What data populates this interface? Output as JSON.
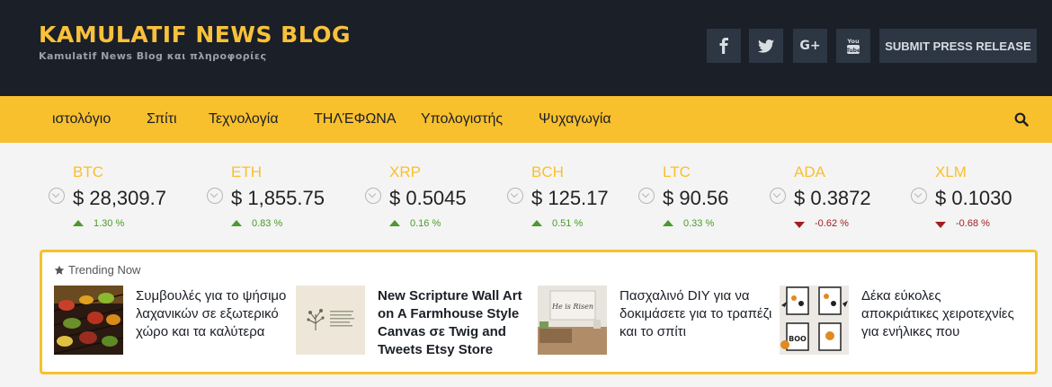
{
  "header": {
    "title": "KAMULATIF NEWS BLOG",
    "tagline": "Kamulatif News Blog και πληροφορίες",
    "social": [
      {
        "icon": "facebook-icon",
        "label": "f"
      },
      {
        "icon": "twitter-icon"
      },
      {
        "icon": "google-plus-icon",
        "label": "G+"
      },
      {
        "icon": "youtube-icon",
        "label": "You Tube"
      }
    ],
    "submit_label": "SUBMIT PRESS RELEASE"
  },
  "nav": {
    "items": [
      "ιστολόγιο",
      "Σπίτι",
      "Τεχνολογία",
      "ΤΗΛΈΦΩΝΑ",
      "Υπολογιστής",
      "Ψυχαγωγία"
    ],
    "search_icon": "search-icon"
  },
  "ticker": [
    {
      "symbol": "BTC",
      "price": "$ 28,309.7",
      "change": "1.30 %",
      "direction": "up"
    },
    {
      "symbol": "ETH",
      "price": "$ 1,855.75",
      "change": "0.83 %",
      "direction": "up"
    },
    {
      "symbol": "XRP",
      "price": "$ 0.5045",
      "change": "0.16 %",
      "direction": "up"
    },
    {
      "symbol": "BCH",
      "price": "$ 125.17",
      "change": "0.51 %",
      "direction": "up"
    },
    {
      "symbol": "LTC",
      "price": "$ 90.56",
      "change": "0.33 %",
      "direction": "up"
    },
    {
      "symbol": "ADA",
      "price": "$ 0.3872",
      "change": "-0.62 %",
      "direction": "down"
    },
    {
      "symbol": "XLM",
      "price": "$ 0.1030",
      "change": "-0.68 %",
      "direction": "down"
    }
  ],
  "trending": {
    "heading": "Trending Now",
    "items": [
      {
        "title": "Συμβουλές για το ψήσιμο λαχανικών σε εξωτερικό χώρο και τα καλύτερα"
      },
      {
        "title": "New Scripture Wall Art on A Farmhouse Style Canvas σε Twig and Tweets Etsy Store"
      },
      {
        "title": "Πασχαλινό DIY για να δοκιμάσετε για το τραπέζι και το σπίτι",
        "thumb_text": "He is Risen"
      },
      {
        "title": "Δέκα εύκολες αποκριάτικες χειροτεχνίες για ενήλικες που",
        "thumb_text": "BOO"
      }
    ]
  },
  "colors": {
    "header_bg": "#1b1f27",
    "accent": "#f9c02d",
    "up": "#4a9a2c",
    "down": "#a02020"
  }
}
